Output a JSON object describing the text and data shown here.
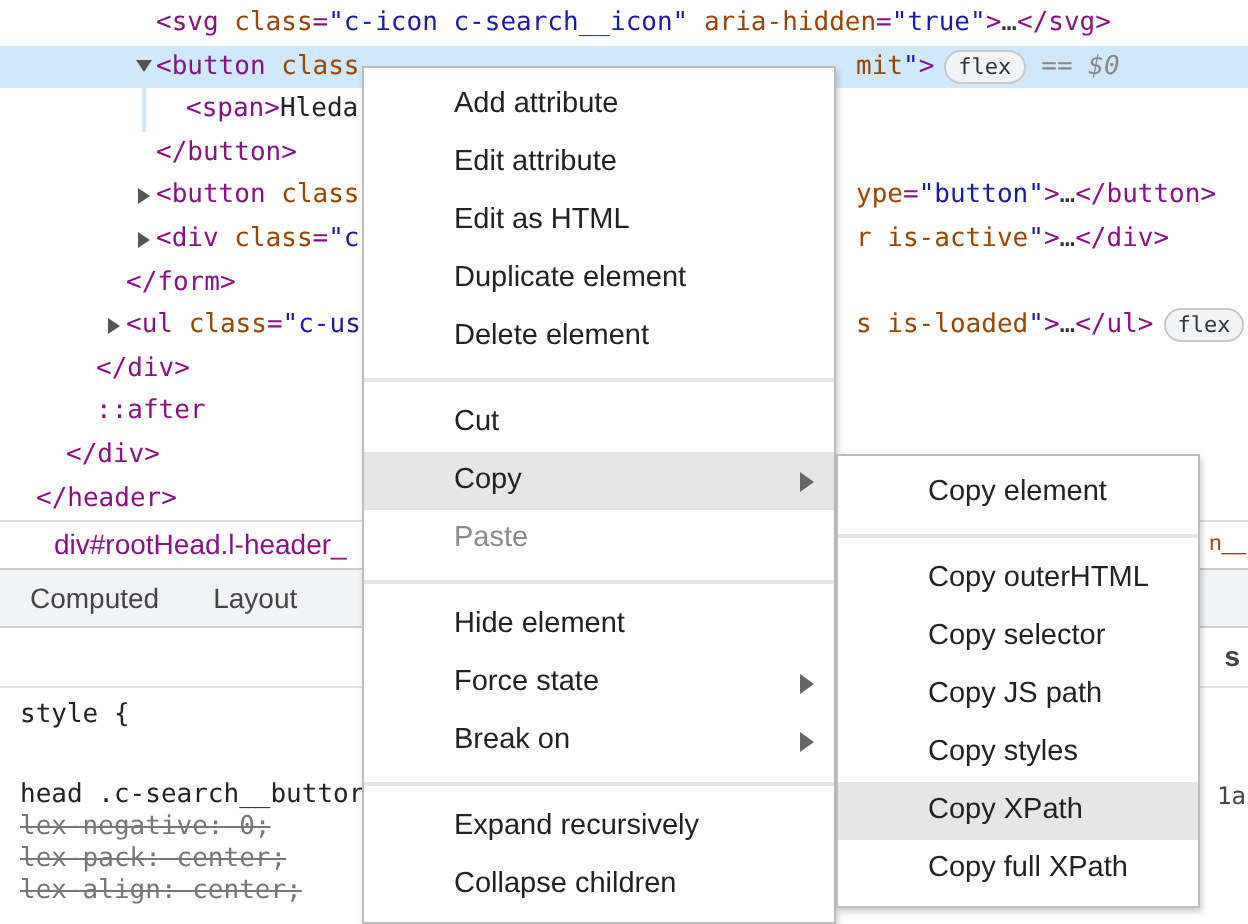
{
  "elements_tree": [
    {
      "close": "</header>",
      "children": [
        {
          "close": "</div>",
          "children": [
            {
              "close": "</div>",
              "children": [
                {
                  "close": "</form>",
                  "children": [
                    {
                      "text": "<svg class=\"c-icon c-search__icon\" aria-hidden=\"true\">…</svg>",
                      "selected": false
                    },
                    {
                      "text": "<button class",
                      "tail": "mit\">",
                      "badge": "flex",
                      "suffix": "== $0",
                      "expanded": true,
                      "selected": true,
                      "close": "</button>",
                      "children": [
                        {
                          "text": "<span>Hleda",
                          "selected": false
                        }
                      ]
                    },
                    {
                      "text": "<button class",
                      "tail": "ype=\"button\">…</button>",
                      "expanded": false,
                      "selected": false
                    },
                    {
                      "text": "<div class=\"c",
                      "tail": "r is-active\">…</div>",
                      "expanded": false,
                      "selected": false
                    }
                  ]
                },
                {
                  "text": "<ul class=\"c-us",
                  "tail": "s is-loaded\">…</ul>",
                  "badge": "flex",
                  "expanded": false,
                  "selected": false
                }
              ]
            },
            {
              "text": "::after",
              "selected": false
            }
          ]
        }
      ]
    }
  ],
  "breadcrumb": {
    "path": "div#rootHead.l-header_",
    "tail": "n__"
  },
  "styles_tabs": [
    {
      "label": "Computed"
    },
    {
      "label": "Layout"
    }
  ],
  "styles_pane": {
    "side_label": "s",
    "lines": [
      {
        "kind": "selector",
        "text": "style {"
      },
      {
        "kind": "selector",
        "text": "head .c-search__buttor",
        "source": "1a"
      },
      {
        "kind": "overridden",
        "text": "lex-negative: 0;"
      },
      {
        "kind": "overridden",
        "text": "lex-pack: center;"
      },
      {
        "kind": "overridden",
        "text": "lex-align: center;"
      }
    ]
  },
  "context_menu": {
    "items": [
      {
        "kind": "item",
        "label": "Add attribute",
        "selected": false,
        "disabled": false,
        "submenu": false
      },
      {
        "kind": "item",
        "label": "Edit attribute",
        "selected": false,
        "disabled": false,
        "submenu": false
      },
      {
        "kind": "item",
        "label": "Edit as HTML",
        "selected": false,
        "disabled": false,
        "submenu": false
      },
      {
        "kind": "item",
        "label": "Duplicate element",
        "selected": false,
        "disabled": false,
        "submenu": false
      },
      {
        "kind": "item",
        "label": "Delete element",
        "selected": false,
        "disabled": false,
        "submenu": false
      },
      {
        "kind": "separator"
      },
      {
        "kind": "item",
        "label": "Cut",
        "selected": false,
        "disabled": false,
        "submenu": false
      },
      {
        "kind": "item",
        "label": "Copy",
        "selected": true,
        "disabled": false,
        "submenu": true
      },
      {
        "kind": "item",
        "label": "Paste",
        "selected": false,
        "disabled": true,
        "submenu": false
      },
      {
        "kind": "separator"
      },
      {
        "kind": "item",
        "label": "Hide element",
        "selected": false,
        "disabled": false,
        "submenu": false
      },
      {
        "kind": "item",
        "label": "Force state",
        "selected": false,
        "disabled": false,
        "submenu": true
      },
      {
        "kind": "item",
        "label": "Break on",
        "selected": false,
        "disabled": false,
        "submenu": true
      },
      {
        "kind": "separator"
      },
      {
        "kind": "item",
        "label": "Expand recursively",
        "selected": false,
        "disabled": false,
        "submenu": false
      },
      {
        "kind": "item",
        "label": "Collapse children",
        "selected": false,
        "disabled": false,
        "submenu": false
      }
    ]
  },
  "copy_submenu": {
    "items": [
      {
        "kind": "item",
        "label": "Copy element",
        "selected": false
      },
      {
        "kind": "separator"
      },
      {
        "kind": "item",
        "label": "Copy outerHTML",
        "selected": false
      },
      {
        "kind": "item",
        "label": "Copy selector",
        "selected": false
      },
      {
        "kind": "item",
        "label": "Copy JS path",
        "selected": false
      },
      {
        "kind": "item",
        "label": "Copy styles",
        "selected": false
      },
      {
        "kind": "item",
        "label": "Copy XPath",
        "selected": true
      },
      {
        "kind": "item",
        "label": "Copy full XPath",
        "selected": false
      }
    ]
  }
}
